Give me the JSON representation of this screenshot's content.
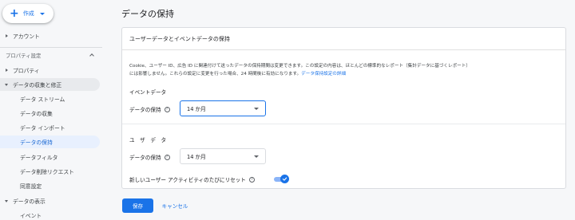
{
  "header": {
    "create_label": "作成"
  },
  "sidebar": {
    "account": "アカウント",
    "section_label": "プロパティ設定",
    "property": "プロパティ",
    "data_collection": "データの収集と修正",
    "sub_items": [
      "データ ストリーム",
      "データの収集",
      "データ インポート",
      "データの保持",
      "データフィルタ",
      "データ削除リクエスト",
      "同意設定"
    ],
    "data_display": "データの表示",
    "events": "イベント"
  },
  "main": {
    "page_title": "データの保持",
    "card_title": "ユーザーデータとイベントデータの保持",
    "description_line1": "Cookie、ユーザー ID、広告 ID に関連付けて送ったデータの保持期間は変更できます。この設定の内容は、ほとんどの標準的なレポート（集計データに基づくレポート）",
    "description_line2": "には影響しません。これらの設定に変更を行った場合、24 時間後に有効になります。",
    "description_link": "データ保持設定の詳細",
    "event_section": "イベントデータ",
    "event_field_label": "データの保持",
    "event_value": "14 か月",
    "user_section": "ユ　ザ　デ　タ",
    "user_field_label": "データの保持",
    "user_value": "14 か月",
    "reset_label": "新しいユーザー アクティビティのたびにリセット",
    "reset_enabled": true,
    "save_label": "保存",
    "cancel_label": "キャンセル"
  },
  "colors": {
    "accent": "#1a73e8",
    "selected_bg": "#e8f0fe"
  }
}
